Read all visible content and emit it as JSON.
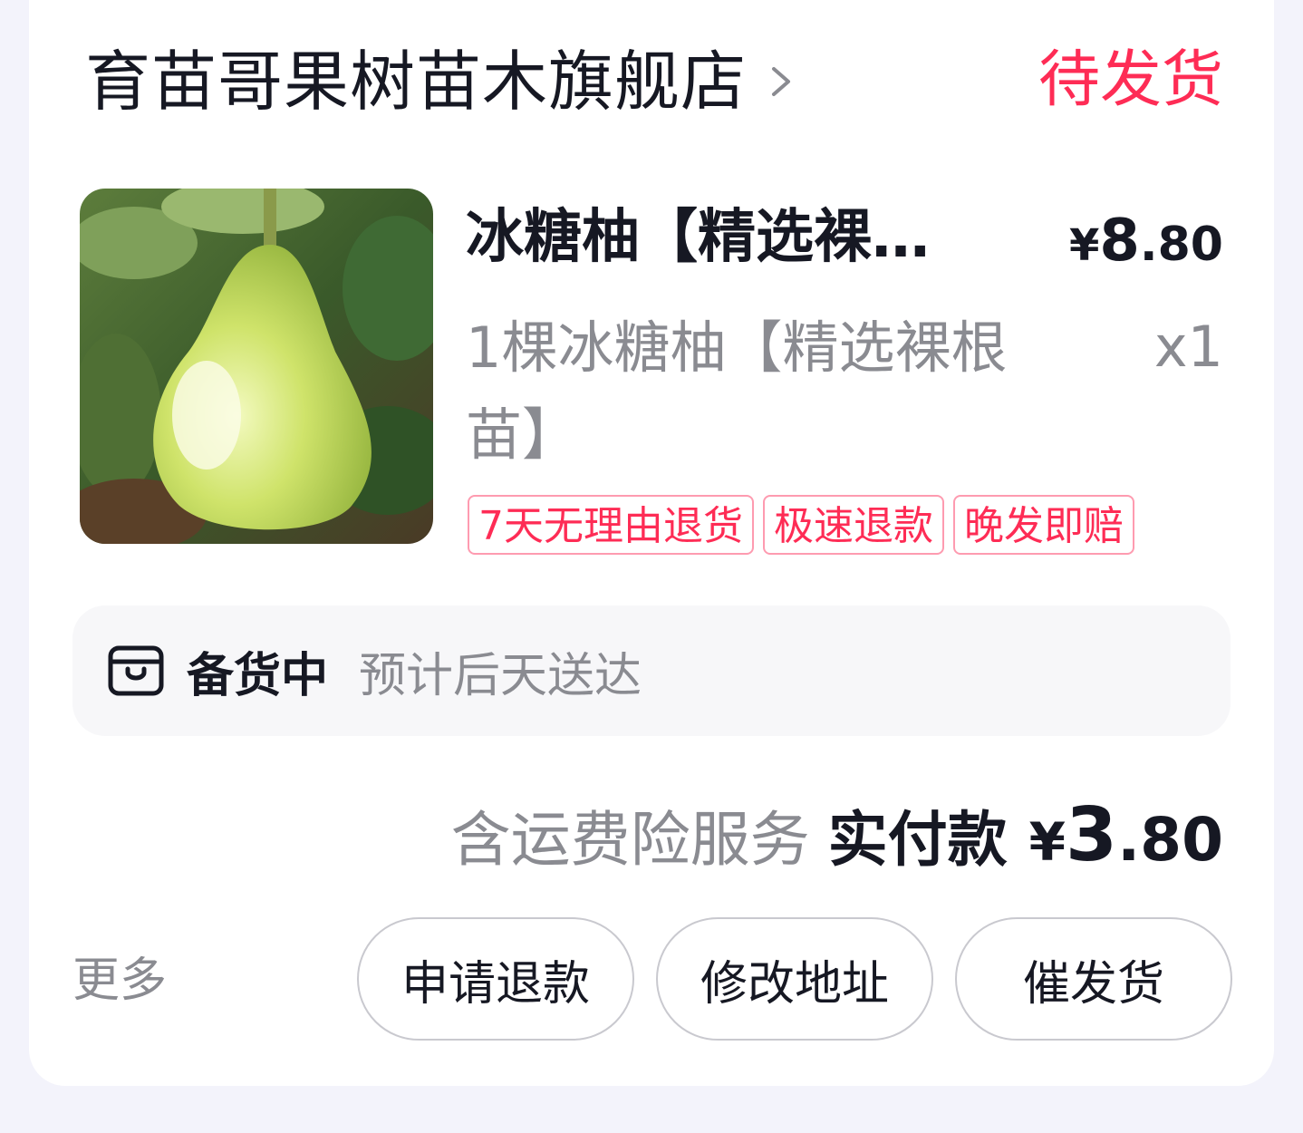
{
  "order": {
    "store_name": "育苗哥果树苗木旗舰店",
    "status": "待发货",
    "product": {
      "title": "冰糖柚【精选裸根苗】",
      "price_currency": "¥",
      "price_int": "8",
      "price_dec": ".80",
      "sku": "1棵冰糖柚【精选裸根苗】",
      "quantity": "x1",
      "image": "pomelo-fruit-photo",
      "tags": [
        "7天无理由退货",
        "极速退款",
        "晚发即赔"
      ]
    },
    "shipping": {
      "icon": "box-icon",
      "status": "备货中",
      "eta": "预计后天送达"
    },
    "total": {
      "insurance_note": "含运费险服务",
      "paid_label": "实付款",
      "currency": "¥",
      "amount_int": "3",
      "amount_dec": ".80"
    },
    "actions": {
      "more": "更多",
      "refund": "申请退款",
      "change_address": "修改地址",
      "urge_shipping": "催发货"
    }
  },
  "colors": {
    "accent": "#fe2c55",
    "text_primary": "#161823",
    "text_secondary": "#8a8b91",
    "page_bg": "#f3f3fb",
    "card_bg": "#ffffff"
  }
}
